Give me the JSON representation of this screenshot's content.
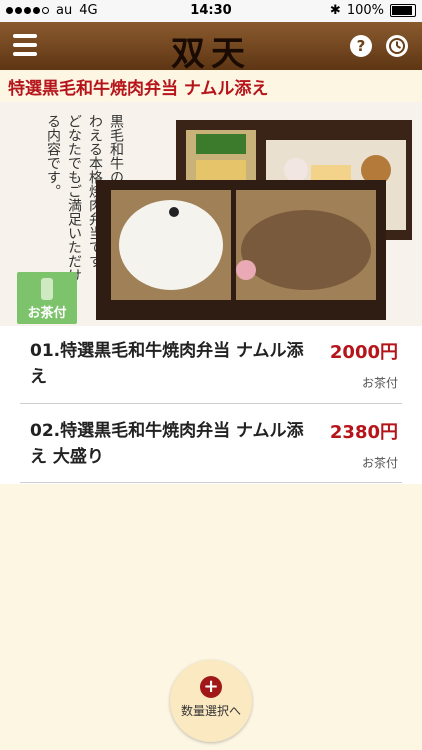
{
  "status_bar": {
    "carrier": "au",
    "network": "4G",
    "time": "14:30",
    "battery": "100%"
  },
  "header": {
    "logo_text": "双天",
    "menu_icon": "hamburger-menu-icon",
    "help_icon": "help-question-icon",
    "history_icon": "clock-icon"
  },
  "product": {
    "title": "特選黒毛和牛焼肉弁当 ナムル添え",
    "description": "黒毛和牛の旨みを存分に味わえる本格焼肉弁当です。どなたでもご満足いただける内容です。",
    "tea_badge": "お茶付"
  },
  "items": [
    {
      "name": "01.特選黒毛和牛焼肉弁当 ナムル添え",
      "price": "2000円",
      "note": "お茶付"
    },
    {
      "name": "02.特選黒毛和牛焼肉弁当 ナムル添え 大盛り",
      "price": "2380円",
      "note": "お茶付"
    }
  ],
  "action": {
    "label": "数量選択へ"
  },
  "colors": {
    "accent": "#b5141a",
    "navbar": "#6b4019",
    "background": "#fdf6e3"
  }
}
